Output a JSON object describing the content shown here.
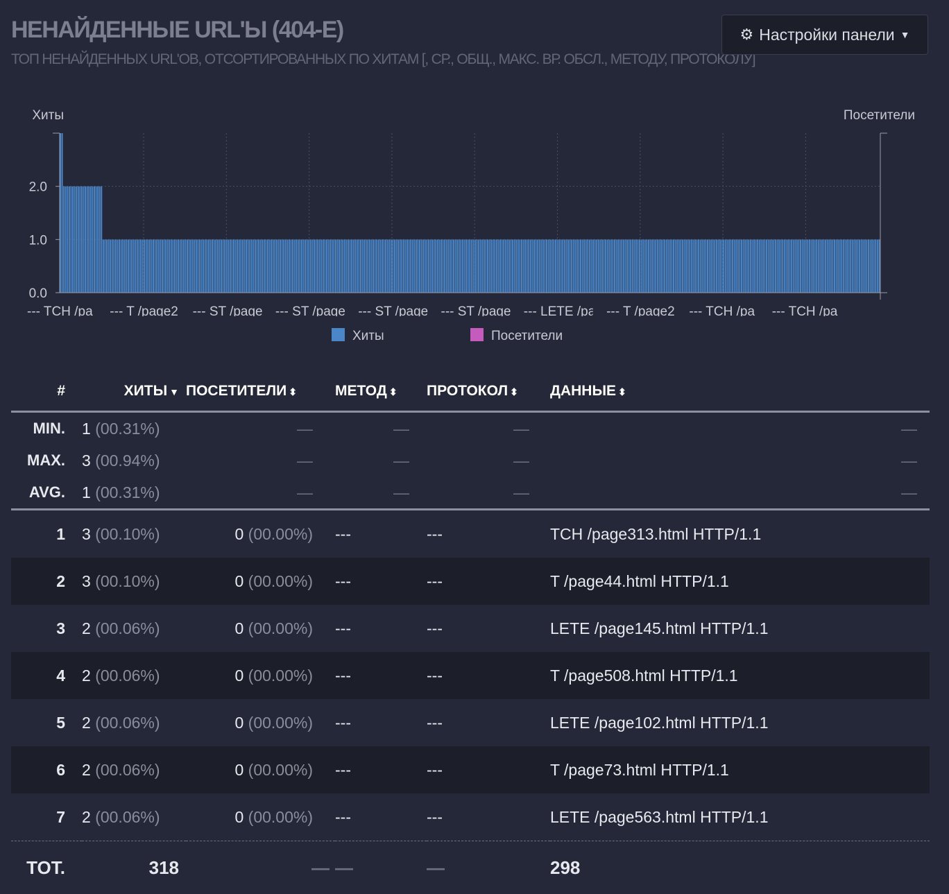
{
  "header": {
    "title": "НЕНАЙДЕННЫЕ URL'Ы (404-Е)",
    "subtitle": "ТОП НЕНАЙДЕННЫХ URL'ОВ, ОТСОРТИРОВАННЫХ ПО ХИТАМ [, СР., ОБЩ., МАКС. ВР. ОБСЛ., МЕТОДУ, ПРОТОКОЛУ]",
    "settings_label": "Настройки панели"
  },
  "chart_data": {
    "type": "bar",
    "y_left_label": "Хиты",
    "y_right_label": "Посетители",
    "y_ticks": [
      "0.0",
      "1.0",
      "2.0"
    ],
    "ylim": [
      0,
      3
    ],
    "x_tick_labels": [
      "--- TCH /pa",
      "--- T /page2",
      "--- ST /page",
      "--- ST /page",
      "--- ST /page",
      "--- ST /page",
      "--- LETE /pa",
      "--- T /page2",
      "--- TCH /pa",
      "--- TCH /pa"
    ],
    "legend": [
      "Хиты",
      "Посетители"
    ],
    "series": [
      {
        "name": "Хиты",
        "color": "#4a86c8",
        "runs": [
          {
            "value": 3,
            "count": 2
          },
          {
            "value": 2,
            "count": 22
          },
          {
            "value": 1,
            "count": 435
          }
        ]
      },
      {
        "name": "Посетители",
        "color": "#c45bbd",
        "runs": [
          {
            "value": 0,
            "count": 459
          }
        ]
      }
    ],
    "grid": true
  },
  "table": {
    "columns": [
      "#",
      "ХИТЫ",
      "ПОСЕТИТЕЛИ",
      "МЕТОД",
      "ПРОТОКОЛ",
      "ДАННЫЕ"
    ],
    "summary": [
      {
        "label": "MIN.",
        "hits": "1",
        "hits_pct": "(00.31%)"
      },
      {
        "label": "MAX.",
        "hits": "3",
        "hits_pct": "(00.94%)"
      },
      {
        "label": "AVG.",
        "hits": "1",
        "hits_pct": "(00.31%)"
      }
    ],
    "dash": "—",
    "rows": [
      {
        "n": "1",
        "hits": "3",
        "hits_pct": "(00.10%)",
        "visitors": "0",
        "visitors_pct": "(00.00%)",
        "method": "---",
        "protocol": "---",
        "data": "TCH /page313.html HTTP/1.1"
      },
      {
        "n": "2",
        "hits": "3",
        "hits_pct": "(00.10%)",
        "visitors": "0",
        "visitors_pct": "(00.00%)",
        "method": "---",
        "protocol": "---",
        "data": "T /page44.html HTTP/1.1"
      },
      {
        "n": "3",
        "hits": "2",
        "hits_pct": "(00.06%)",
        "visitors": "0",
        "visitors_pct": "(00.00%)",
        "method": "---",
        "protocol": "---",
        "data": "LETE /page145.html HTTP/1.1"
      },
      {
        "n": "4",
        "hits": "2",
        "hits_pct": "(00.06%)",
        "visitors": "0",
        "visitors_pct": "(00.00%)",
        "method": "---",
        "protocol": "---",
        "data": "T /page508.html HTTP/1.1"
      },
      {
        "n": "5",
        "hits": "2",
        "hits_pct": "(00.06%)",
        "visitors": "0",
        "visitors_pct": "(00.00%)",
        "method": "---",
        "protocol": "---",
        "data": "LETE /page102.html HTTP/1.1"
      },
      {
        "n": "6",
        "hits": "2",
        "hits_pct": "(00.06%)",
        "visitors": "0",
        "visitors_pct": "(00.00%)",
        "method": "---",
        "protocol": "---",
        "data": "T /page73.html HTTP/1.1"
      },
      {
        "n": "7",
        "hits": "2",
        "hits_pct": "(00.06%)",
        "visitors": "0",
        "visitors_pct": "(00.00%)",
        "method": "---",
        "protocol": "---",
        "data": "LETE /page563.html HTTP/1.1"
      }
    ],
    "total": {
      "label": "TOT.",
      "hits": "318",
      "data": "298"
    }
  }
}
